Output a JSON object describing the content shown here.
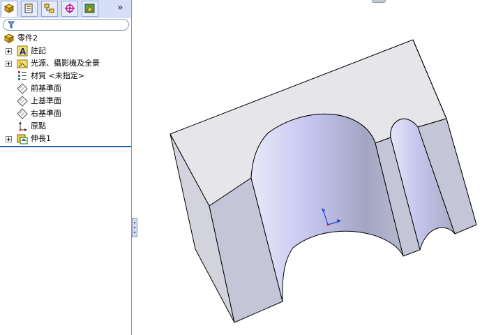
{
  "feature_manager": {
    "tabs": [
      {
        "name": "featuremanager-tab",
        "active": true
      },
      {
        "name": "propertymanager-tab",
        "active": false
      },
      {
        "name": "configurationmanager-tab",
        "active": false
      },
      {
        "name": "dimxpert-tab",
        "active": false
      },
      {
        "name": "display-manager-tab",
        "active": false
      }
    ],
    "expand_glyph": "»",
    "tree": [
      {
        "label": "零件2",
        "icon": "part-icon",
        "expandable": false,
        "indent": 0
      },
      {
        "label": "註記",
        "icon": "annotations-icon",
        "expandable": true,
        "indent": 1
      },
      {
        "label": "光源、攝影機及全景",
        "icon": "lights-cameras-icon",
        "expandable": true,
        "indent": 1
      },
      {
        "label": "材質 <未指定>",
        "icon": "material-icon",
        "expandable": false,
        "indent": 1
      },
      {
        "label": "前基準面",
        "icon": "plane-icon",
        "expandable": false,
        "indent": 1
      },
      {
        "label": "上基準面",
        "icon": "plane-icon",
        "expandable": false,
        "indent": 1
      },
      {
        "label": "右基準面",
        "icon": "plane-icon",
        "expandable": false,
        "indent": 1
      },
      {
        "label": "原點",
        "icon": "origin-icon",
        "expandable": false,
        "indent": 1
      },
      {
        "label": "伸長1",
        "icon": "extrude-icon",
        "expandable": true,
        "indent": 1
      }
    ]
  },
  "colors": {
    "tab_strip": "#d6dff7",
    "rollback_bar": "#1d5fb3",
    "model_top": "#e6e6ea",
    "model_side": "#c4c6d8",
    "model_edge": "#000000"
  }
}
